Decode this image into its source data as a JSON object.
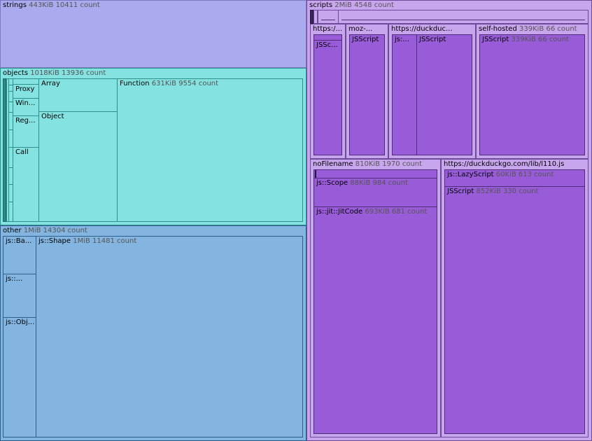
{
  "strings": {
    "label": "strings",
    "meta": "443KiB 10411 count"
  },
  "objects": {
    "label": "objects",
    "meta": "1018KiB 13936 count",
    "proxy": "Proxy",
    "window": "Win...",
    "regexp": "Reg...",
    "call": "Call",
    "array": "Array",
    "object": "Object",
    "function": {
      "label": "Function",
      "meta": "631KiB 9554 count"
    }
  },
  "other": {
    "label": "other",
    "meta": "1MiB 14304 count",
    "base": "js::Ba...",
    "js": "js::...",
    "obj": "js::Obj...",
    "shape": {
      "label": "js::Shape",
      "meta": "1MiB 11481 count"
    }
  },
  "scripts": {
    "label": "scripts",
    "meta": "2MiB 4548 count",
    "https": {
      "label": "https:/...",
      "child": "JSSc..."
    },
    "moz": {
      "label": "moz-...",
      "child": "JSScript"
    },
    "duck": {
      "label": "https://duckduc...",
      "child1": "js:...",
      "child2": "JSScript"
    },
    "selfhosted": {
      "label": "self-hosted",
      "meta": "339KiB 66 count",
      "child": {
        "label": "JSScript",
        "meta": "339KiB 66 count"
      }
    },
    "nofile": {
      "label": "noFilename",
      "meta": "810KiB 1970 count",
      "scope": {
        "label": "js::Scope",
        "meta": "88KiB 984 count"
      },
      "jitcode": {
        "label": "js::jit::JitCode",
        "meta": "693KiB 681 count"
      }
    },
    "l110": {
      "label": "https://duckduckgo.com/lib/l110.js",
      "lazy": {
        "label": "js::LazyScript",
        "meta": "60KiB 613 count"
      },
      "jsscript": {
        "label": "JSScript",
        "meta": "852KiB 330 count"
      }
    }
  }
}
